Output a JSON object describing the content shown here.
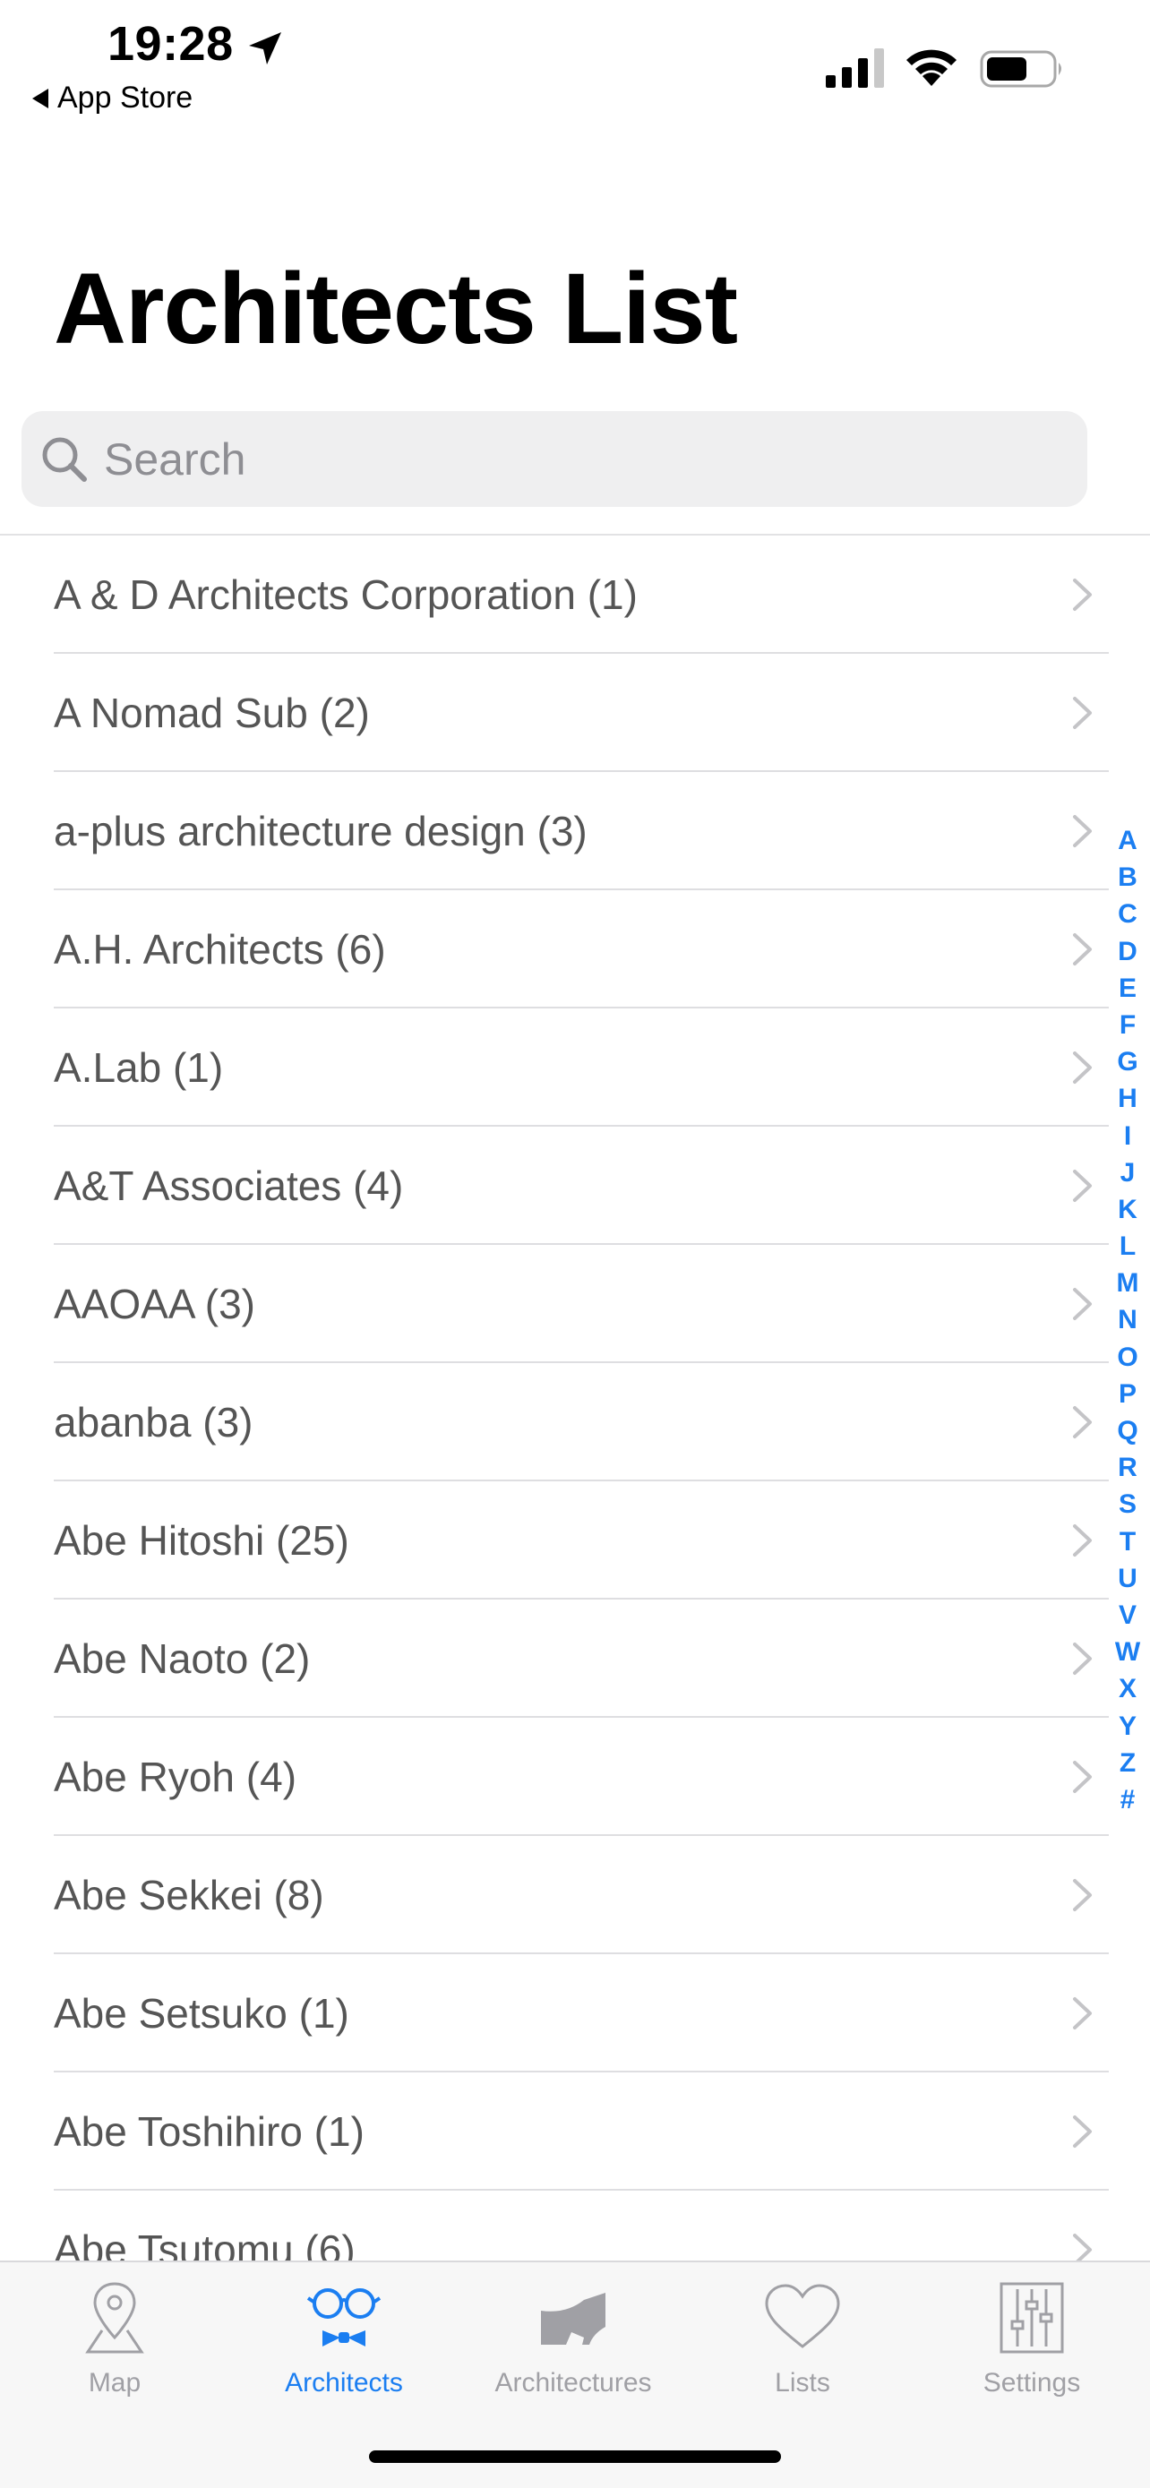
{
  "status_bar": {
    "time": "19:28",
    "back_label": "App Store"
  },
  "header": {
    "title": "Architects List"
  },
  "search": {
    "placeholder": "Search"
  },
  "architects": [
    "A & D Architects Corporation (1)",
    "A Nomad Sub (2)",
    "a-plus architecture design (3)",
    "A.H. Architects (6)",
    "A.Lab (1)",
    "A&T Associates (4)",
    "AAOAA (3)",
    "abanba (3)",
    "Abe Hitoshi (25)",
    "Abe Naoto (2)",
    "Abe Ryoh (4)",
    "Abe Sekkei (8)",
    "Abe Setsuko (1)",
    "Abe Toshihiro (1)",
    "Abe Tsutomu (6)"
  ],
  "index_letters": [
    "A",
    "B",
    "C",
    "D",
    "E",
    "F",
    "G",
    "H",
    "I",
    "J",
    "K",
    "L",
    "M",
    "N",
    "O",
    "P",
    "Q",
    "R",
    "S",
    "T",
    "U",
    "V",
    "W",
    "X",
    "Y",
    "Z",
    "#"
  ],
  "tabs": [
    {
      "label": "Map",
      "icon": "map-pin-icon",
      "active": false
    },
    {
      "label": "Architects",
      "icon": "glasses-bowtie-icon",
      "active": true
    },
    {
      "label": "Architectures",
      "icon": "building-icon",
      "active": false
    },
    {
      "label": "Lists",
      "icon": "heart-icon",
      "active": false
    },
    {
      "label": "Settings",
      "icon": "sliders-icon",
      "active": false
    }
  ],
  "colors": {
    "accent": "#1b7ef1",
    "inactive": "#a0a0a5",
    "row_text": "#555555",
    "search_bg": "#efeff0"
  }
}
